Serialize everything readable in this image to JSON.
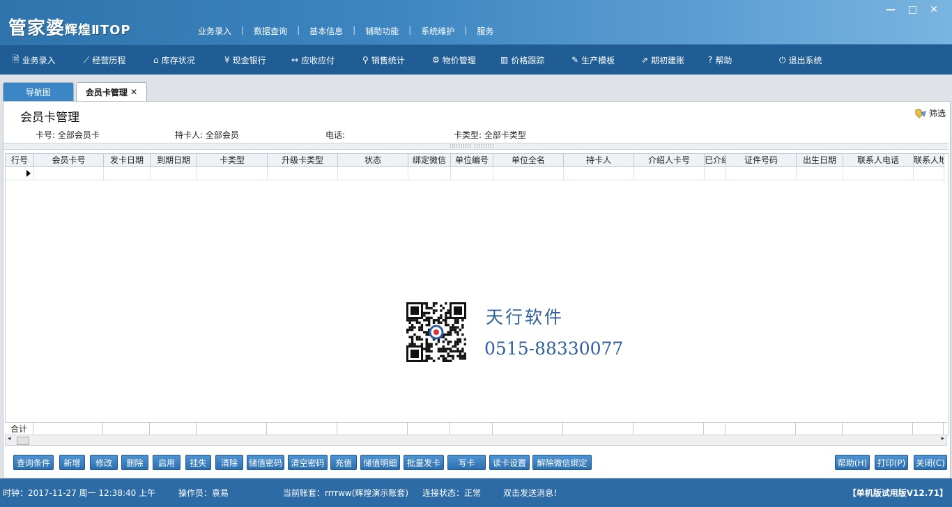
{
  "app": {
    "logo_main": "管家婆",
    "logo_sub": "辉煌",
    "logo_tail": "ⅡTOP",
    "window_controls": [
      "—",
      "□",
      "✕"
    ]
  },
  "top_menu": [
    "业务录入",
    "数据查询",
    "基本信息",
    "辅助功能",
    "系统维护",
    "服务"
  ],
  "toolbar": [
    {
      "icon": "document-icon",
      "glyph": "🗎",
      "label": "业务录入"
    },
    {
      "icon": "line-chart-icon",
      "glyph": "⟋",
      "label": "经营历程"
    },
    {
      "icon": "home-icon",
      "glyph": "⌂",
      "label": "库存状况"
    },
    {
      "icon": "yen-icon",
      "glyph": "¥",
      "label": "现金银行"
    },
    {
      "icon": "exchange-icon",
      "glyph": "↔",
      "label": "应收应付"
    },
    {
      "icon": "search-icon",
      "glyph": "⚲",
      "label": "销售统计"
    },
    {
      "icon": "gear-icon",
      "glyph": "⚙",
      "label": "物价管理"
    },
    {
      "icon": "bar-chart-icon",
      "glyph": "▥",
      "label": "价格跟踪"
    },
    {
      "icon": "wrench-icon",
      "glyph": "✎",
      "label": "生产模板"
    },
    {
      "icon": "external-link-icon",
      "glyph": "⇗",
      "label": "期初建账"
    },
    {
      "icon": "help-icon",
      "glyph": "?",
      "label": "帮助"
    },
    {
      "icon": "power-icon",
      "glyph": "⏻",
      "label": "退出系统"
    }
  ],
  "tabs": [
    {
      "label": "导航图"
    },
    {
      "label": "会员卡管理",
      "close": "✕"
    }
  ],
  "page": {
    "title": "会员卡管理",
    "filter_label": "筛选",
    "criteria": [
      {
        "label": "卡号:",
        "value": "全部会员卡"
      },
      {
        "label": "持卡人:",
        "value": "全部会员"
      },
      {
        "label": "电话:",
        "value": ""
      },
      {
        "label": "卡类型:",
        "value": "全部卡类型"
      }
    ]
  },
  "grid": {
    "columns": [
      "行号",
      "会员卡号",
      "发卡日期",
      "到期日期",
      "卡类型",
      "升级卡类型",
      "状态",
      "绑定微信",
      "单位编号",
      "单位全名",
      "持卡人",
      "介绍人卡号",
      "已介绍",
      "证件号码",
      "出生日期",
      "联系人电话",
      "联系人地"
    ],
    "sum_label": "合计"
  },
  "watermark": {
    "brand": "天行软件",
    "phone": "0515-88330077"
  },
  "buttons": {
    "left": [
      "查询条件",
      "新增",
      "修改",
      "删除",
      "启用",
      "挂失",
      "清除",
      "储值密码",
      "清空密码",
      "充值",
      "储值明细",
      "批量发卡",
      "写卡",
      "读卡设置",
      "解除微信绑定"
    ],
    "right": [
      "帮助(H)",
      "打印(P)",
      "关闭(C)"
    ]
  },
  "status": {
    "clock": "时钟：2017-11-27 周一 12:38:40 上午",
    "operator": "操作员：袁易",
    "account": "当前账套：rrrrww(辉煌演示账套)",
    "connection": "连接状态：正常",
    "message": "双击发送消息！",
    "version": "【单机版试用版V12.71】"
  }
}
